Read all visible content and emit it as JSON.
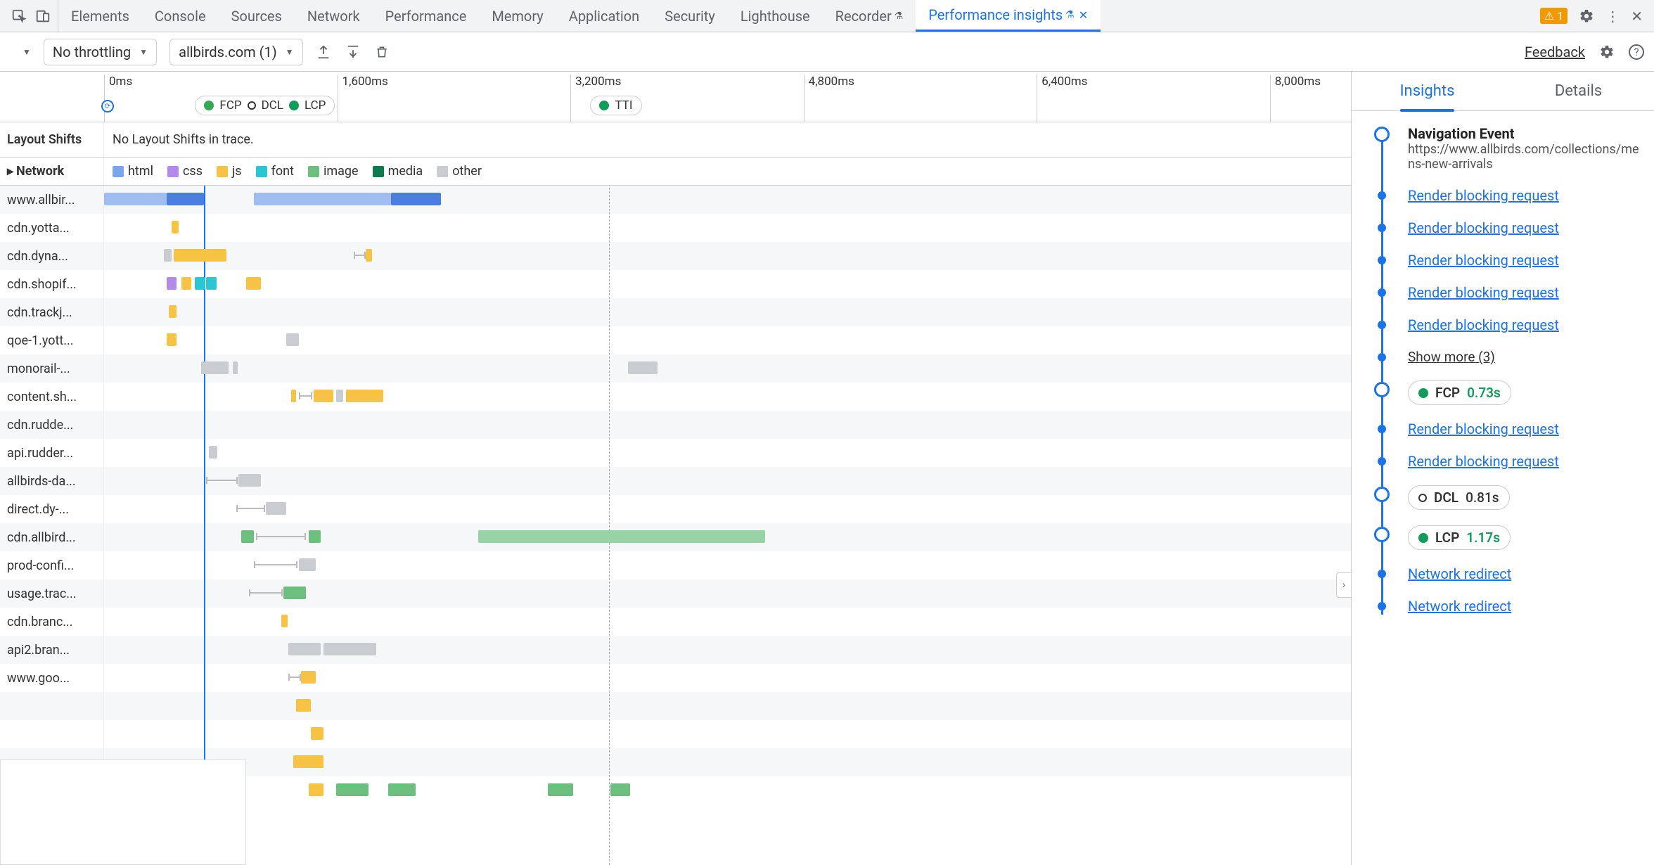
{
  "topTabs": {
    "items": [
      "Elements",
      "Console",
      "Sources",
      "Network",
      "Performance",
      "Memory",
      "Application",
      "Security",
      "Lighthouse",
      "Recorder",
      "Performance insights"
    ],
    "activeIndex": 10,
    "flaskIndices": [
      9,
      10
    ],
    "warningCount": "1"
  },
  "toolbar": {
    "throttlingLabel": "No throttling",
    "recordingLabel": "allbirds.com (1)",
    "feedback": "Feedback"
  },
  "timeline": {
    "ticks": [
      {
        "label": "0ms",
        "pct": 0
      },
      {
        "label": "1,600ms",
        "pct": 18.7
      },
      {
        "label": "3,200ms",
        "pct": 37.4
      },
      {
        "label": "4,800ms",
        "pct": 56.1
      },
      {
        "label": "6,400ms",
        "pct": 74.8
      },
      {
        "label": "8,000ms",
        "pct": 93.5
      }
    ],
    "playheadPct": 8.0,
    "dashedPct": 40.5,
    "markerPill1": {
      "leftPct": 7.3,
      "items": [
        {
          "dot": "greenlight",
          "label": "FCP"
        },
        {
          "dot": "hollow",
          "label": "DCL"
        },
        {
          "dot": "green",
          "label": "LCP"
        }
      ]
    },
    "markerPill2": {
      "leftPct": 39.0,
      "items": [
        {
          "dot": "green",
          "label": "TTI"
        }
      ]
    }
  },
  "layoutShifts": {
    "label": "Layout Shifts",
    "text": "No Layout Shifts in trace."
  },
  "networkLegend": {
    "label": "Network",
    "items": [
      {
        "cls": "c-html",
        "label": "html"
      },
      {
        "cls": "c-css",
        "label": "css"
      },
      {
        "cls": "c-js",
        "label": "js"
      },
      {
        "cls": "c-font",
        "label": "font"
      },
      {
        "cls": "c-image",
        "label": "image"
      },
      {
        "cls": "c-media",
        "label": "media"
      },
      {
        "cls": "c-other",
        "label": "other"
      }
    ]
  },
  "networkRows": [
    {
      "label": "www.allbir...",
      "bars": [
        {
          "l": 0,
          "w": 8,
          "c": "#9fbdf0"
        },
        {
          "l": 5,
          "w": 3,
          "c": "#4a7fe0"
        },
        {
          "l": 12,
          "w": 11,
          "c": "#9fbdf0"
        },
        {
          "l": 23,
          "w": 4,
          "c": "#4a7fe0"
        }
      ]
    },
    {
      "label": "cdn.yotta...",
      "bars": [
        {
          "l": 5.4,
          "w": 0.6,
          "c": "#f6c344"
        }
      ]
    },
    {
      "label": "cdn.dyna...",
      "bars": [
        {
          "l": 4.8,
          "w": 0.6,
          "c": "#c9ccd1"
        },
        {
          "l": 5.6,
          "w": 4.2,
          "c": "#f6c344"
        },
        {
          "l": 21,
          "w": 0.5,
          "c": "#f6c344"
        }
      ],
      "whiskers": [
        {
          "l": 20,
          "w": 1
        }
      ]
    },
    {
      "label": "cdn.shopif...",
      "bars": [
        {
          "l": 5,
          "w": 0.8,
          "c": "#b48ae8"
        },
        {
          "l": 6.2,
          "w": 0.8,
          "c": "#f6c344"
        },
        {
          "l": 7.3,
          "w": 0.8,
          "c": "#2cc5d3"
        },
        {
          "l": 8.2,
          "w": 0.8,
          "c": "#2cc5d3"
        },
        {
          "l": 11.4,
          "w": 1.2,
          "c": "#f6c344"
        }
      ]
    },
    {
      "label": "cdn.trackj...",
      "bars": [
        {
          "l": 5.2,
          "w": 0.6,
          "c": "#f6c344"
        }
      ]
    },
    {
      "label": "qoe-1.yott...",
      "bars": [
        {
          "l": 5,
          "w": 0.8,
          "c": "#f6c344"
        },
        {
          "l": 14.6,
          "w": 1,
          "c": "#c9ccd1"
        }
      ]
    },
    {
      "label": "monorail-...",
      "bars": [
        {
          "l": 7.8,
          "w": 2.2,
          "c": "#c9ccd1"
        },
        {
          "l": 10.3,
          "w": 0.4,
          "c": "#c9ccd1"
        },
        {
          "l": 42,
          "w": 2.4,
          "c": "#c9ccd1"
        }
      ]
    },
    {
      "label": "content.sh...",
      "bars": [
        {
          "l": 15,
          "w": 0.4,
          "c": "#f6c344"
        },
        {
          "l": 16.8,
          "w": 1.6,
          "c": "#f6c344"
        },
        {
          "l": 18.6,
          "w": 0.6,
          "c": "#c9ccd1"
        },
        {
          "l": 19.4,
          "w": 3,
          "c": "#f6c344"
        }
      ],
      "whiskers": [
        {
          "l": 15.6,
          "w": 1.1
        }
      ]
    },
    {
      "label": "cdn.rudde...",
      "bars": []
    },
    {
      "label": "api.rudder...",
      "bars": [
        {
          "l": 8.4,
          "w": 0.7,
          "c": "#c9ccd1"
        }
      ]
    },
    {
      "label": "allbirds-da...",
      "bars": [
        {
          "l": 10.8,
          "w": 1.8,
          "c": "#c9ccd1"
        }
      ],
      "whiskers": [
        {
          "l": 8.2,
          "w": 2.5
        }
      ]
    },
    {
      "label": "direct.dy-...",
      "bars": [
        {
          "l": 13,
          "w": 1.6,
          "c": "#c9ccd1"
        }
      ],
      "whiskers": [
        {
          "l": 10.6,
          "w": 2.3
        }
      ]
    },
    {
      "label": "cdn.allbird...",
      "bars": [
        {
          "l": 11,
          "w": 1,
          "c": "#6dbf7e"
        },
        {
          "l": 16.4,
          "w": 1,
          "c": "#6dbf7e"
        },
        {
          "l": 30,
          "w": 23,
          "c": "#97d3a5"
        }
      ],
      "whiskers": [
        {
          "l": 12.2,
          "w": 4
        }
      ]
    },
    {
      "label": "prod-confi...",
      "bars": [
        {
          "l": 15.6,
          "w": 1.4,
          "c": "#c9ccd1"
        }
      ],
      "whiskers": [
        {
          "l": 12,
          "w": 3.5
        }
      ]
    },
    {
      "label": "usage.trac...",
      "bars": [
        {
          "l": 14.4,
          "w": 1.8,
          "c": "#6dbf7e"
        }
      ],
      "whiskers": [
        {
          "l": 11.6,
          "w": 2.7
        }
      ]
    },
    {
      "label": "cdn.branc...",
      "bars": [
        {
          "l": 14.2,
          "w": 0.5,
          "c": "#f6c344"
        }
      ]
    },
    {
      "label": "api2.bran...",
      "bars": [
        {
          "l": 14.8,
          "w": 2.6,
          "c": "#c9ccd1"
        },
        {
          "l": 17.6,
          "w": 4.2,
          "c": "#c9ccd1"
        }
      ]
    },
    {
      "label": "www.goo...",
      "bars": [
        {
          "l": 15.8,
          "w": 1.2,
          "c": "#f6c344"
        }
      ],
      "whiskers": [
        {
          "l": 14.8,
          "w": 1
        }
      ]
    },
    {
      "label": "",
      "bars": [
        {
          "l": 15.4,
          "w": 1.2,
          "c": "#f6c344"
        }
      ]
    },
    {
      "label": "",
      "bars": [
        {
          "l": 16.6,
          "w": 1,
          "c": "#f6c344"
        }
      ]
    },
    {
      "label": "",
      "bars": [
        {
          "l": 15.2,
          "w": 2.4,
          "c": "#f6c344"
        }
      ]
    },
    {
      "label": "",
      "bars": [
        {
          "l": 16.4,
          "w": 1.2,
          "c": "#f6c344"
        },
        {
          "l": 18.6,
          "w": 2.6,
          "c": "#6dbf7e"
        },
        {
          "l": 22.8,
          "w": 2.2,
          "c": "#6dbf7e"
        },
        {
          "l": 35.6,
          "w": 2,
          "c": "#6dbf7e"
        },
        {
          "l": 40.6,
          "w": 1.6,
          "c": "#6dbf7e"
        }
      ]
    }
  ],
  "rightPanel": {
    "tabs": [
      "Insights",
      "Details"
    ],
    "activeTab": 0,
    "items": [
      {
        "type": "big",
        "title": "Navigation Event",
        "sub": "https://www.allbirds.com/collections/mens-new-arrivals"
      },
      {
        "type": "link",
        "text": "Render blocking request"
      },
      {
        "type": "link",
        "text": "Render blocking request"
      },
      {
        "type": "link",
        "text": "Render blocking request"
      },
      {
        "type": "link",
        "text": "Render blocking request"
      },
      {
        "type": "link",
        "text": "Render blocking request"
      },
      {
        "type": "showmore",
        "text": "Show more (3)"
      },
      {
        "type": "pill",
        "dot": "green",
        "metric": "FCP",
        "value": "0.73s",
        "valClass": "val-green",
        "big": true
      },
      {
        "type": "link",
        "text": "Render blocking request"
      },
      {
        "type": "link",
        "text": "Render blocking request"
      },
      {
        "type": "pill",
        "dot": "hollow",
        "metric": "DCL",
        "value": "0.81s",
        "valClass": "val-dark",
        "big": true
      },
      {
        "type": "pill",
        "dot": "green",
        "metric": "LCP",
        "value": "1.17s",
        "valClass": "val-green",
        "big": true
      },
      {
        "type": "link",
        "text": "Network redirect"
      },
      {
        "type": "link",
        "text": "Network redirect"
      }
    ]
  }
}
